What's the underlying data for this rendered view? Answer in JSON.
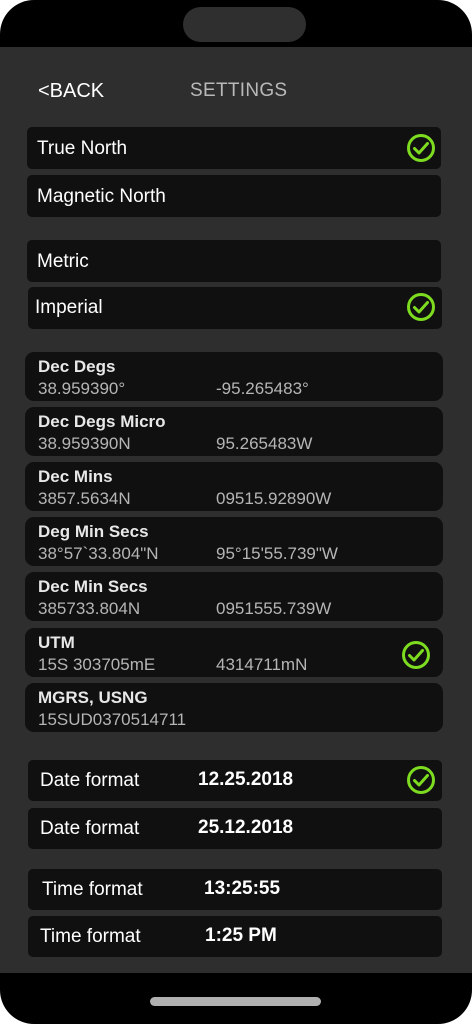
{
  "nav": {
    "back_label": "<BACK",
    "title": "SETTINGS"
  },
  "north_options": [
    {
      "label": "True North",
      "selected": true
    },
    {
      "label": "Magnetic North",
      "selected": false
    }
  ],
  "unit_options": [
    {
      "label": "Metric",
      "selected": false
    },
    {
      "label": "Imperial",
      "selected": true
    }
  ],
  "coordinate_formats": [
    {
      "name": "Dec Degs",
      "value_a": "38.959390°",
      "value_b": "-95.265483°",
      "selected": false
    },
    {
      "name": "Dec Degs Micro",
      "value_a": "38.959390N",
      "value_b": "95.265483W",
      "selected": false
    },
    {
      "name": "Dec Mins",
      "value_a": "3857.5634N",
      "value_b": "09515.92890W",
      "selected": false
    },
    {
      "name": "Deg Min Secs",
      "value_a": "38°57`33.804\"N",
      "value_b": "95°15'55.739\"W",
      "selected": false
    },
    {
      "name": "Dec Min Secs",
      "value_a": "385733.804N",
      "value_b": "0951555.739W",
      "selected": false
    },
    {
      "name": "UTM",
      "value_a": "15S 303705mE",
      "value_b": "4314711mN",
      "selected": true
    },
    {
      "name": "MGRS, USNG",
      "value_a": "15SUD0370514711",
      "value_b": "",
      "selected": false
    }
  ],
  "date_formats": [
    {
      "label": "Date format",
      "value": "12.25.2018",
      "selected": true
    },
    {
      "label": "Date format",
      "value": "25.12.2018",
      "selected": false
    }
  ],
  "time_formats": [
    {
      "label": "Time format",
      "value": "13:25:55",
      "selected": false
    },
    {
      "label": "Time format",
      "value": "1:25 PM",
      "selected": false
    }
  ],
  "colors": {
    "check": "#7ddc1f",
    "row_bg": "#101010",
    "screen_bg": "#2e2e2e"
  }
}
